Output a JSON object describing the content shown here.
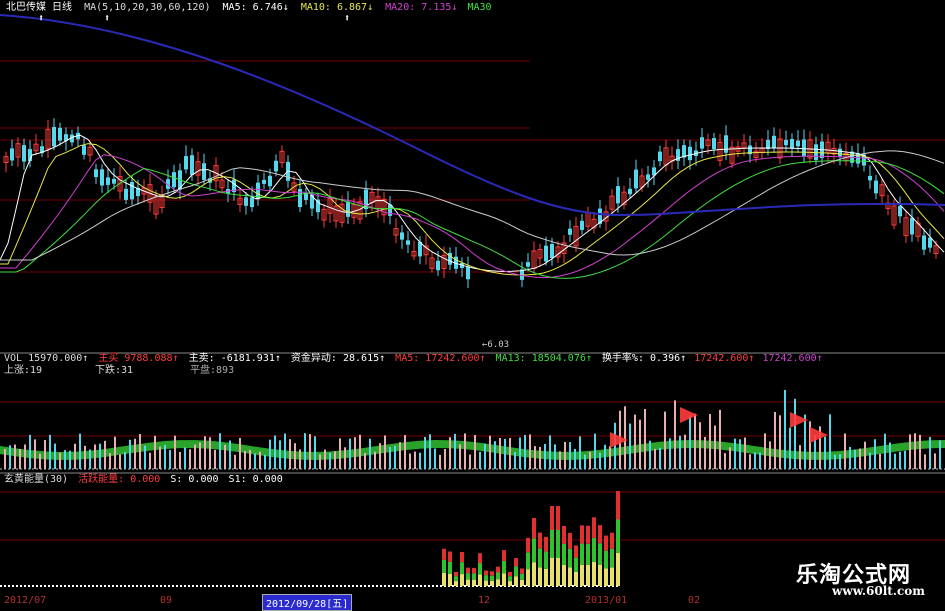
{
  "colors": {
    "up": "#ff3b3b",
    "down": "#55d8ee",
    "ma5": "#ffffff",
    "ma10": "#e8e84a",
    "ma20": "#d040d0",
    "ma30": "#40e040",
    "ma_long": "#2a2ab8",
    "grid": "#700000"
  },
  "price_header": {
    "name": "北巴传媒",
    "period": "日线",
    "ma_params": "MA(5,10,20,30,60,120)",
    "ma5_label": "MA5:",
    "ma5_value": "6.746",
    "ma10_label": "MA10:",
    "ma10_value": "6.867",
    "ma20_label": "MA20:",
    "ma20_value": "7.135",
    "ma30_label": "MA30"
  },
  "price_annotation": "6.03",
  "volume_header": {
    "vol_label": "VOL",
    "vol_value": "15970.000",
    "zhuli_label": "主买",
    "zhuli_value": "9788.088",
    "zhumai_label": "主卖:",
    "zhumai_value": "-6181.931",
    "fund_label": "资金异动:",
    "fund_value": "28.615",
    "ma5_label": "MA5:",
    "ma5_value": "17242.600",
    "ma13_label": "MA13:",
    "ma13_value": "18504.076",
    "turnover_label": "换手率%:",
    "turnover_value": "0.396",
    "v1_value": "17242.600",
    "v2_value": "17242.600"
  },
  "breadth": {
    "up_label": "上涨:",
    "up_value": "19",
    "down_label": "下跌:",
    "down_value": "31",
    "flat_label": "平盘:",
    "flat_value": "893"
  },
  "energy_header": {
    "title": "玄黄能量(30)",
    "active_label": "活跃能量:",
    "active_value": "0.000",
    "s_label": "S:",
    "s_value": "0.000",
    "s1_label": "S1:",
    "s1_value": "0.000"
  },
  "x_axis": {
    "labels": [
      "2012/07",
      "09",
      "2012/09/28[五]",
      "12",
      "2013/01",
      "02"
    ]
  },
  "watermark": {
    "name": "乐淘公式网",
    "url": "www.60lt.com"
  },
  "chart_data": {
    "type": "candlestick",
    "title": "北巴传媒 日线",
    "series": [
      {
        "name": "MA5",
        "value": 6.746
      },
      {
        "name": "MA10",
        "value": 6.867
      },
      {
        "name": "MA20",
        "value": 7.135
      },
      {
        "name": "MA30"
      }
    ],
    "visible_low": 6.03,
    "x_labels": [
      "2012/07",
      "09",
      "2012/09/28[五]",
      "12",
      "2013/01",
      "02"
    ]
  }
}
